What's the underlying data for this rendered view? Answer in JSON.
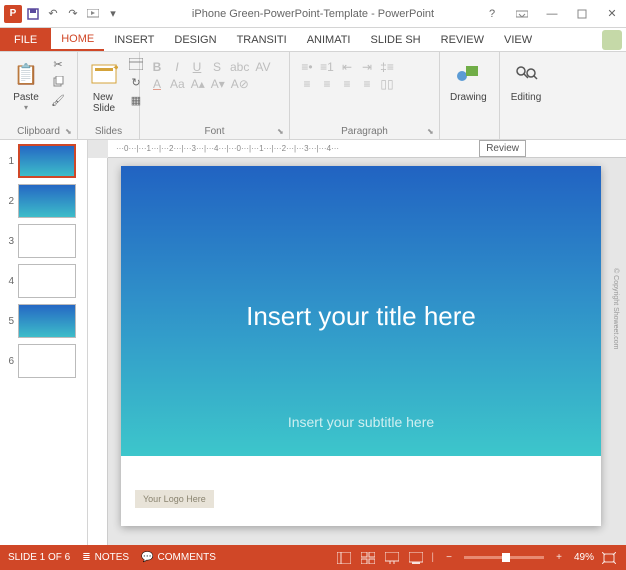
{
  "app": {
    "doc_name": "iPhone Green-PowerPoint-Template",
    "app_name": "PowerPoint"
  },
  "tabs": {
    "file": "FILE",
    "items": [
      "HOME",
      "INSERT",
      "DESIGN",
      "TRANSITI",
      "ANIMATI",
      "SLIDE SH",
      "REVIEW",
      "VIEW"
    ],
    "active_index": 0
  },
  "ribbon": {
    "clipboard": {
      "label": "Clipboard",
      "paste": "Paste"
    },
    "slides": {
      "label": "Slides",
      "new_slide": "New\nSlide"
    },
    "font": {
      "label": "Font"
    },
    "paragraph": {
      "label": "Paragraph"
    },
    "drawing": {
      "label": "Drawing"
    },
    "editing": {
      "label": "Editing"
    }
  },
  "tooltip": "Review",
  "slides_panel": {
    "count": 6,
    "active": 1
  },
  "slide": {
    "title": "Insert your title here",
    "subtitle": "Insert your subtitle here",
    "logo_placeholder": "Your Logo Here",
    "copyright": "© Copyright Showeet.com"
  },
  "status": {
    "slide_info": "SLIDE 1 OF 6",
    "notes": "NOTES",
    "comments": "COMMENTS",
    "zoom": "49%"
  },
  "colors": {
    "accent": "#d04727"
  }
}
